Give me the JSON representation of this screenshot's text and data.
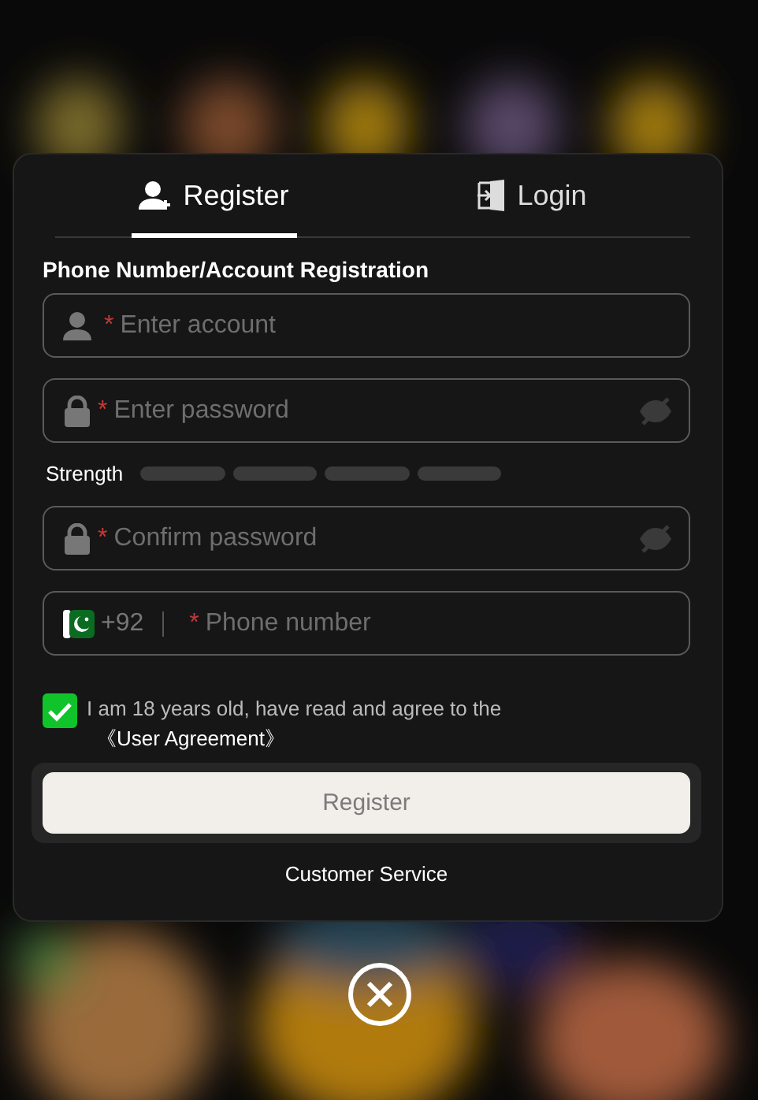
{
  "tabs": [
    {
      "label": "Register",
      "selected": true,
      "kind": "register"
    },
    {
      "label": "Login",
      "selected": false,
      "kind": "login"
    }
  ],
  "section_title": "Phone Number/Account Registration",
  "fields": [
    {
      "kind": "account",
      "required_mark": "*",
      "placeholder": "Enter account"
    },
    {
      "kind": "password",
      "required_mark": "*",
      "placeholder": "Enter password"
    },
    {
      "kind": "strength",
      "label": "Strength"
    },
    {
      "kind": "password",
      "required_mark": "*",
      "placeholder": "Confirm password"
    },
    {
      "kind": "phone",
      "country_code": "+92",
      "required_mark": "*",
      "placeholder": "Phone number"
    }
  ],
  "agreement": {
    "checked": true,
    "text": "I am 18 years old, have read and agree to the",
    "link": "《User Agreement》"
  },
  "submit": {
    "label": "Register"
  },
  "customer_service": "Customer Service"
}
